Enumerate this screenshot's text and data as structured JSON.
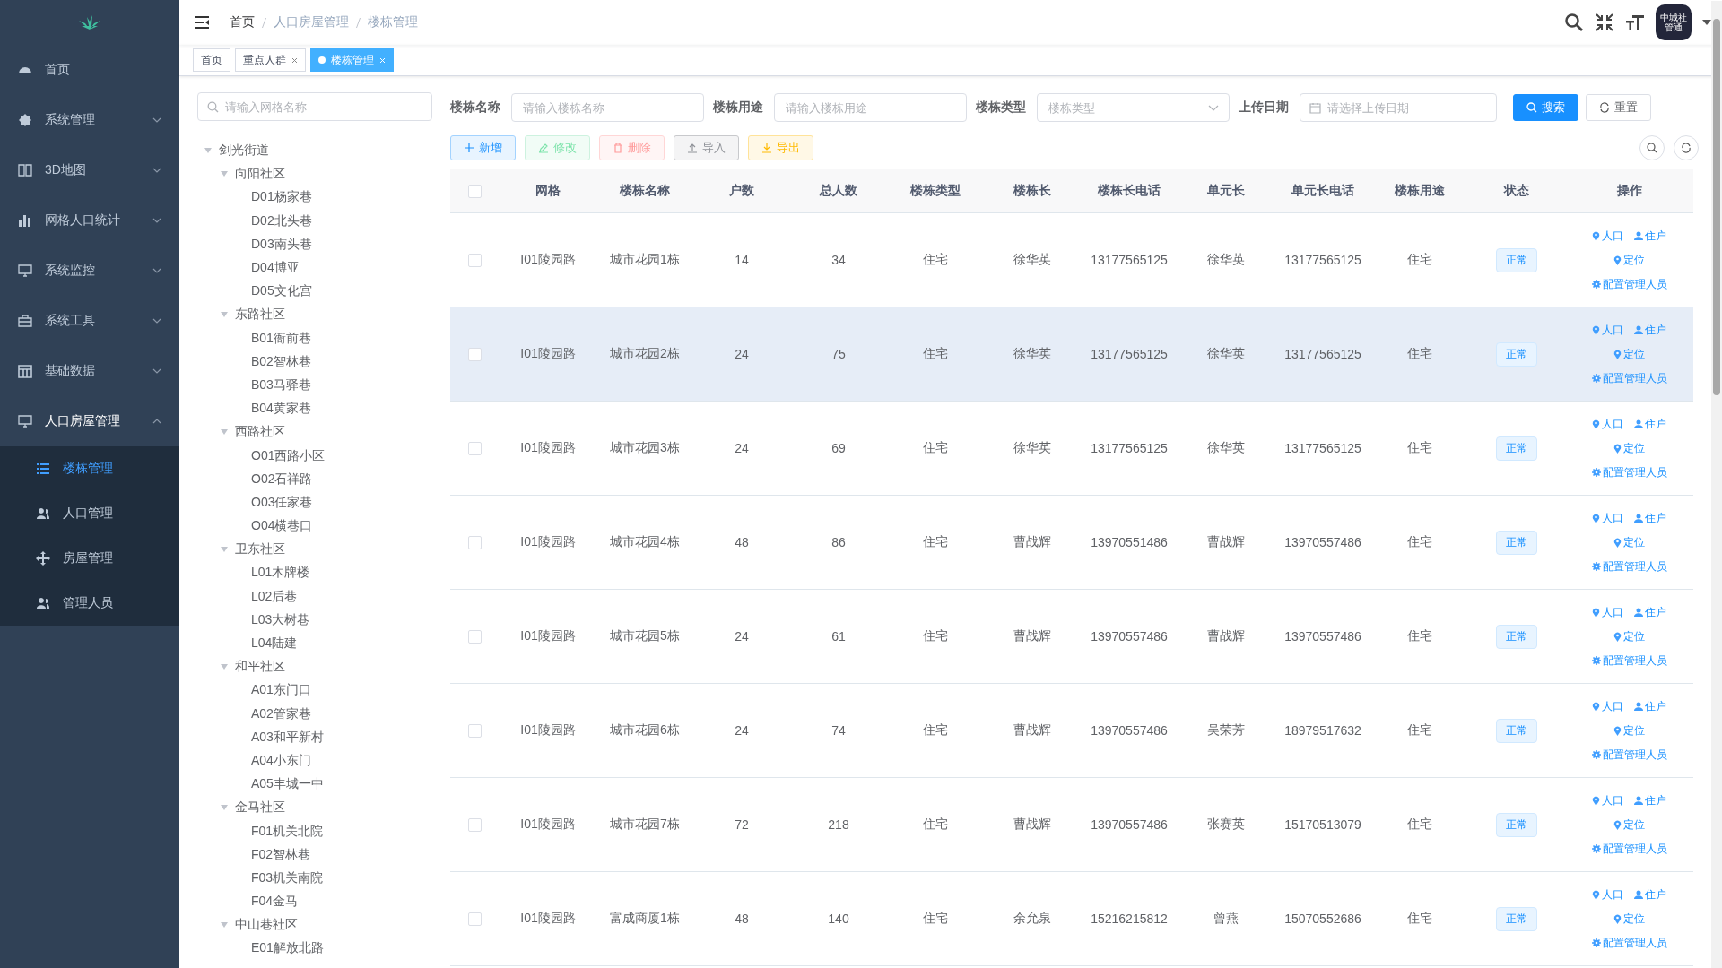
{
  "sidebar": {
    "items": [
      {
        "label": "首页"
      },
      {
        "label": "系统管理",
        "expanded": false
      },
      {
        "label": "3D地图",
        "expanded": false
      },
      {
        "label": "网格人口统计",
        "expanded": false
      },
      {
        "label": "系统监控",
        "expanded": false
      },
      {
        "label": "系统工具",
        "expanded": false
      },
      {
        "label": "基础数据",
        "expanded": false
      },
      {
        "label": "人口房屋管理",
        "expanded": true,
        "children": [
          {
            "label": "楼栋管理",
            "selected": true
          },
          {
            "label": "人口管理",
            "selected": false
          },
          {
            "label": "房屋管理",
            "selected": false
          },
          {
            "label": "管理人员",
            "selected": false
          }
        ]
      }
    ]
  },
  "header": {
    "breadcrumb": [
      "首页",
      "人口房屋管理",
      "楼栋管理"
    ],
    "avatar_text": "中城社管通"
  },
  "tabs": [
    {
      "label": "首页",
      "selected": false,
      "closable": false
    },
    {
      "label": "重点人群",
      "selected": false,
      "closable": true
    },
    {
      "label": "楼栋管理",
      "selected": true,
      "closable": true
    }
  ],
  "tree": {
    "search": {
      "placeholder": "请输入网格名称"
    },
    "nodes": [
      {
        "label": "剑光街道",
        "expanded": true,
        "children": [
          {
            "label": "向阳社区",
            "expanded": true,
            "children": [
              {
                "label": "D01杨家巷"
              },
              {
                "label": "D02北头巷"
              },
              {
                "label": "D03南头巷"
              },
              {
                "label": "D04博亚"
              },
              {
                "label": "D05文化宫"
              }
            ]
          },
          {
            "label": "东路社区",
            "expanded": true,
            "children": [
              {
                "label": "B01衙前巷"
              },
              {
                "label": "B02智林巷"
              },
              {
                "label": "B03马驿巷"
              },
              {
                "label": "B04黄家巷"
              }
            ]
          },
          {
            "label": "西路社区",
            "expanded": true,
            "children": [
              {
                "label": "O01西路小区"
              },
              {
                "label": "O02石祥路"
              },
              {
                "label": "O03任家巷"
              },
              {
                "label": "O04横巷口"
              }
            ]
          },
          {
            "label": "卫东社区",
            "expanded": true,
            "children": [
              {
                "label": "L01木牌楼"
              },
              {
                "label": "L02后巷"
              },
              {
                "label": "L03大树巷"
              },
              {
                "label": "L04陆建"
              }
            ]
          },
          {
            "label": "和平社区",
            "expanded": true,
            "children": [
              {
                "label": "A01东门口"
              },
              {
                "label": "A02管家巷"
              },
              {
                "label": "A03和平新村"
              },
              {
                "label": "A04小东门"
              },
              {
                "label": "A05丰城一中"
              }
            ]
          },
          {
            "label": "金马社区",
            "expanded": true,
            "children": [
              {
                "label": "F01机关北院"
              },
              {
                "label": "F02智林巷"
              },
              {
                "label": "F03机关南院"
              },
              {
                "label": "F04金马"
              }
            ]
          },
          {
            "label": "中山巷社区",
            "expanded": true,
            "children": [
              {
                "label": "E01解放北路"
              }
            ]
          }
        ]
      }
    ]
  },
  "filters": [
    {
      "label": "楼栋名称",
      "placeholder": "请输入楼栋名称",
      "kind": "text"
    },
    {
      "label": "楼栋用途",
      "placeholder": "请输入楼栋用途",
      "kind": "text"
    },
    {
      "label": "楼栋类型",
      "placeholder": "楼栋类型",
      "kind": "select"
    },
    {
      "label": "上传日期",
      "placeholder": "请选择上传日期",
      "kind": "date"
    }
  ],
  "filter_buttons": [
    {
      "label": "搜索",
      "kind": "primary"
    },
    {
      "label": "重置",
      "kind": "plain"
    }
  ],
  "toolbar": [
    {
      "label": "新增",
      "kind": "primary",
      "disabled": false
    },
    {
      "label": "修改",
      "kind": "success",
      "disabled": true
    },
    {
      "label": "删除",
      "kind": "danger",
      "disabled": true
    },
    {
      "label": "导入",
      "kind": "info",
      "disabled": false
    },
    {
      "label": "导出",
      "kind": "warning",
      "disabled": false
    }
  ],
  "table": {
    "select_all": {
      "checked": false
    },
    "columns": [
      "网格",
      "楼栋名称",
      "户数",
      "总人数",
      "楼栋类型",
      "楼栋长",
      "楼栋长电话",
      "单元长",
      "单元长电话",
      "楼栋用途",
      "状态",
      "操作"
    ],
    "rows": [
      {
        "checked": false,
        "highlighted": false,
        "cells": [
          "I01陵园路",
          "城市花园1栋",
          "14",
          "34",
          "住宅",
          "徐华英",
          "13177565125",
          "徐华英",
          "13177565125",
          "住宅"
        ],
        "status": "正常",
        "actions": [
          "人口",
          "住户",
          "定位",
          "配置管理人员"
        ]
      },
      {
        "checked": false,
        "highlighted": true,
        "cells": [
          "I01陵园路",
          "城市花园2栋",
          "24",
          "75",
          "住宅",
          "徐华英",
          "13177565125",
          "徐华英",
          "13177565125",
          "住宅"
        ],
        "status": "正常",
        "actions": [
          "人口",
          "住户",
          "定位",
          "配置管理人员"
        ]
      },
      {
        "checked": false,
        "highlighted": false,
        "cells": [
          "I01陵园路",
          "城市花园3栋",
          "24",
          "69",
          "住宅",
          "徐华英",
          "13177565125",
          "徐华英",
          "13177565125",
          "住宅"
        ],
        "status": "正常",
        "actions": [
          "人口",
          "住户",
          "定位",
          "配置管理人员"
        ]
      },
      {
        "checked": false,
        "highlighted": false,
        "cells": [
          "I01陵园路",
          "城市花园4栋",
          "48",
          "86",
          "住宅",
          "曹战辉",
          "13970551486",
          "曹战辉",
          "13970557486",
          "住宅"
        ],
        "status": "正常",
        "actions": [
          "人口",
          "住户",
          "定位",
          "配置管理人员"
        ]
      },
      {
        "checked": false,
        "highlighted": false,
        "cells": [
          "I01陵园路",
          "城市花园5栋",
          "24",
          "61",
          "住宅",
          "曹战辉",
          "13970557486",
          "曹战辉",
          "13970557486",
          "住宅"
        ],
        "status": "正常",
        "actions": [
          "人口",
          "住户",
          "定位",
          "配置管理人员"
        ]
      },
      {
        "checked": false,
        "highlighted": false,
        "cells": [
          "I01陵园路",
          "城市花园6栋",
          "24",
          "74",
          "住宅",
          "曹战辉",
          "13970557486",
          "吴荣芳",
          "18979517632",
          "住宅"
        ],
        "status": "正常",
        "actions": [
          "人口",
          "住户",
          "定位",
          "配置管理人员"
        ]
      },
      {
        "checked": false,
        "highlighted": false,
        "cells": [
          "I01陵园路",
          "城市花园7栋",
          "72",
          "218",
          "住宅",
          "曹战辉",
          "13970557486",
          "张赛英",
          "15170513079",
          "住宅"
        ],
        "status": "正常",
        "actions": [
          "人口",
          "住户",
          "定位",
          "配置管理人员"
        ]
      },
      {
        "checked": false,
        "highlighted": false,
        "cells": [
          "I01陵园路",
          "富成商厦1栋",
          "48",
          "140",
          "住宅",
          "余允泉",
          "15216215812",
          "曾燕",
          "15070552686",
          "住宅"
        ],
        "status": "正常",
        "actions": [
          "人口",
          "住户",
          "定位",
          "配置管理人员"
        ]
      }
    ]
  }
}
